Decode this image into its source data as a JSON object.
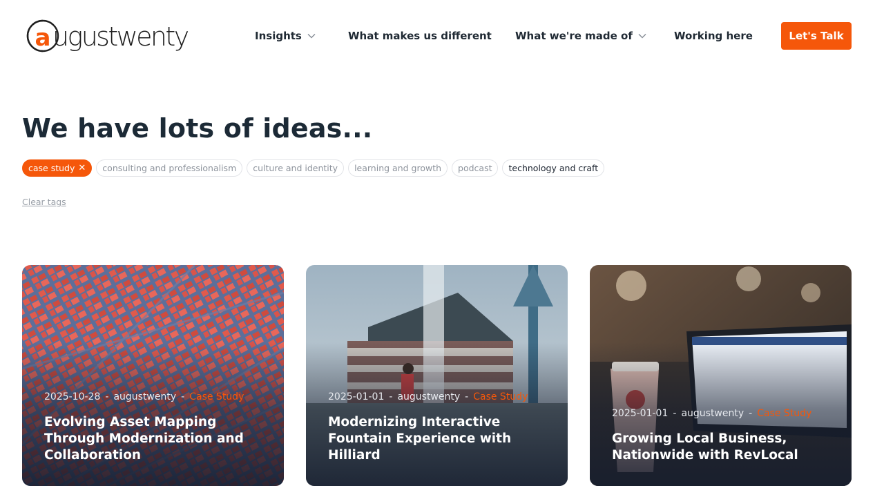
{
  "brand": {
    "logo_text": "augustwenty",
    "accent": "#f5570a"
  },
  "nav": {
    "insights": "Insights",
    "different": "What makes us different",
    "made_of": "What we're made of",
    "working": "Working here",
    "cta": "Let's Talk"
  },
  "main": {
    "title": "We have lots of ideas...",
    "tags": [
      {
        "label": "case study",
        "active": true
      },
      {
        "label": "consulting and professionalism",
        "active": false
      },
      {
        "label": "culture and identity",
        "active": false
      },
      {
        "label": "learning and growth",
        "active": false
      },
      {
        "label": "podcast",
        "active": false
      },
      {
        "label": "technology and craft",
        "active": false
      }
    ],
    "clear_tags": "Clear tags"
  },
  "cards": [
    {
      "date": "2025-10-28",
      "author": "augustwenty",
      "category": "Case Study",
      "title": "Evolving Asset Mapping Through Modernization and Collaboration"
    },
    {
      "date": "2025-01-01",
      "author": "augustwenty",
      "category": "Case Study",
      "title": "Modernizing Interactive Fountain Experience with Hilliard"
    },
    {
      "date": "2025-01-01",
      "author": "augustwenty",
      "category": "Case Study",
      "title": "Growing Local Business, Nationwide with RevLocal"
    }
  ],
  "icons": {
    "chevron": "chevron-down-icon",
    "close": "close-icon"
  }
}
